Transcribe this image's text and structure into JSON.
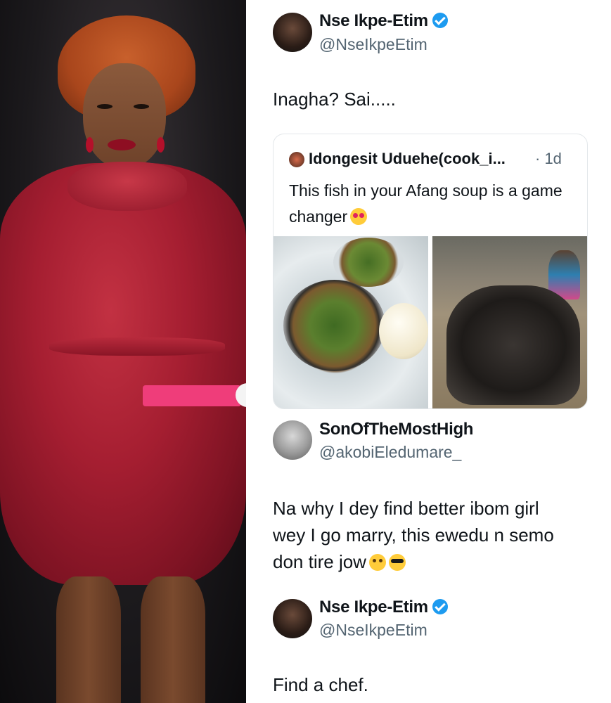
{
  "tweet_main": {
    "name": "Nse Ikpe-Etim",
    "handle": "@NseIkpeEtim",
    "text": "Inagha? Sai....."
  },
  "quoted_tweet": {
    "name": "Idongesit Uduehe(cook_i...",
    "time": "· 1d",
    "text": "This fish in your Afang soup is a game changer",
    "emoji": "heart-eyes-emoji"
  },
  "reply_tweet": {
    "name": "SonOfTheMostHigh",
    "handle": "@akobiEledumare_",
    "text_line1": "Na why I dey find better ibom girl",
    "text_line2": "wey I go marry, this ewedu n semo",
    "text_line3": "don tire jow",
    "emojis": [
      "flushed-emoji",
      "sunglasses-emoji"
    ]
  },
  "reply_response": {
    "name": "Nse Ikpe-Etim",
    "handle": "@NseIkpeEtim",
    "text": "Find a chef."
  },
  "colors": {
    "verified_badge": "#1d9bf0",
    "handle_grey": "#536471",
    "dress_red": "#a51e31"
  }
}
